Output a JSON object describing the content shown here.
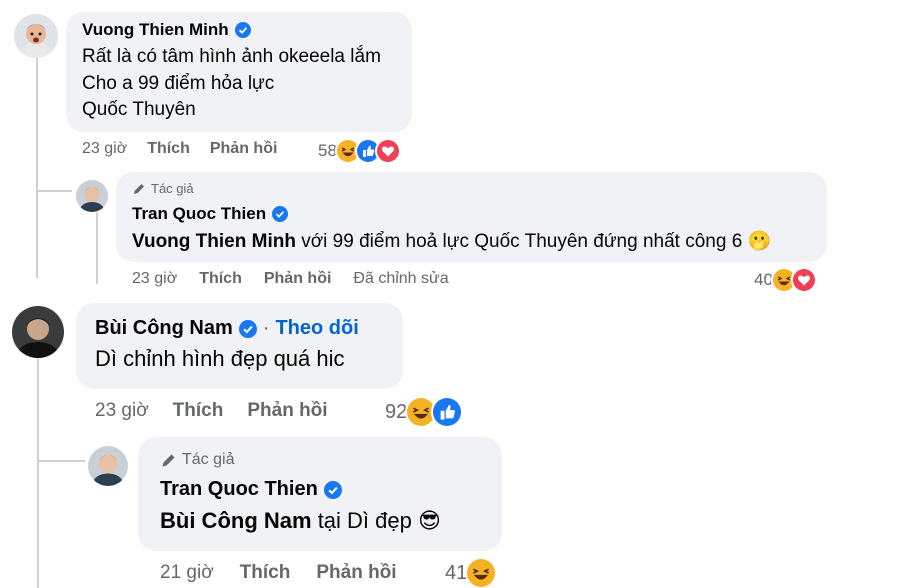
{
  "comments": [
    {
      "author": "Vuong Thien Minh",
      "lines": [
        "Rất là có tâm hình ảnh okeeela lắm",
        "Cho a 99 điểm hỏa lực",
        "Quốc Thuyên"
      ],
      "time": "23 giờ",
      "like_label": "Thích",
      "reply_label": "Phản hồi",
      "reaction_count": "58",
      "reactions": [
        "haha-icon",
        "like-icon",
        "love-icon"
      ],
      "reply": {
        "badge": "Tác giả",
        "author": "Tran Quoc Thien",
        "mention": "Vuong Thien Minh",
        "text": "với 99 điểm hoả lực Quốc Thuyên đứng nhất công 6 🫢",
        "time": "23 giờ",
        "like_label": "Thích",
        "reply_label": "Phản hồi",
        "edited_label": "Đã chỉnh sửa",
        "reaction_count": "40",
        "reactions": [
          "haha-icon",
          "love-icon"
        ]
      }
    },
    {
      "author": "Bùi Công Nam",
      "follow_label": "Theo dõi",
      "lines": [
        "Dì chỉnh hình đẹp quá hic"
      ],
      "time": "23 giờ",
      "like_label": "Thích",
      "reply_label": "Phản hồi",
      "reaction_count": "92",
      "reactions": [
        "haha-icon",
        "like-icon"
      ],
      "reply": {
        "badge": "Tác giả",
        "author": "Tran Quoc Thien",
        "mention": "Bùi Công Nam",
        "text": "tại Dì đẹp 😎",
        "time": "21 giờ",
        "like_label": "Thích",
        "reply_label": "Phản hồi",
        "reaction_count": "41",
        "reactions": [
          "haha-icon"
        ]
      }
    }
  ],
  "colors": {
    "bubble": "#f0f2f5",
    "meta_text": "#65676b",
    "verified": "#1877f2",
    "follow": "#0064d1",
    "like": "#1877f2",
    "love": "#f33e58",
    "haha": "#f7b125"
  }
}
